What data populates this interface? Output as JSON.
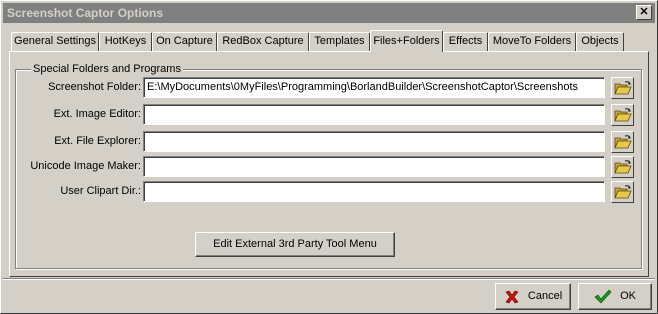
{
  "window": {
    "title": "Screenshot Captor Options",
    "close_glyph": "✕"
  },
  "tabs": [
    {
      "label": "General Settings",
      "active": false
    },
    {
      "label": "HotKeys",
      "active": false
    },
    {
      "label": "On Capture",
      "active": false
    },
    {
      "label": "RedBox Capture",
      "active": false
    },
    {
      "label": "Templates",
      "active": false
    },
    {
      "label": "Files+Folders",
      "active": true
    },
    {
      "label": "Effects",
      "active": false
    },
    {
      "label": "MoveTo Folders",
      "active": false
    },
    {
      "label": "Objects",
      "active": false
    }
  ],
  "group": {
    "title": "Special Folders and Programs"
  },
  "rows": [
    {
      "label": "Screenshot Folder:",
      "value": "E:\\MyDocuments\\0MyFiles\\Programming\\BorlandBuilder\\ScreenshotCaptor\\Screenshots"
    },
    {
      "label": "Ext. Image Editor:",
      "value": ""
    },
    {
      "label": "Ext. File Explorer:",
      "value": ""
    },
    {
      "label": "Unicode Image Maker:",
      "value": ""
    },
    {
      "label": "User Clipart Dir.:",
      "value": ""
    }
  ],
  "buttons": {
    "edit_tool_menu": "Edit External 3rd Party Tool Menu",
    "cancel": "Cancel",
    "ok": "OK"
  },
  "icons": {
    "browse": "open-folder-icon",
    "cancel": "red-x-icon",
    "ok": "green-check-icon"
  },
  "colors": {
    "face": "#d4d0c8",
    "titlebar_inactive": "#808080",
    "cancel_icon": "#cc1111",
    "ok_icon": "#1a9a1a",
    "folder_icon": "#e8c84a"
  }
}
